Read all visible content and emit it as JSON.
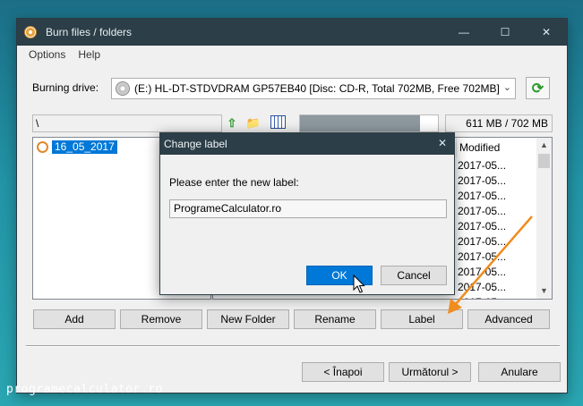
{
  "window": {
    "title": "Burn files / folders"
  },
  "menu": [
    "Options",
    "Help"
  ],
  "drive": {
    "label": "Burning drive:",
    "value": "(E:) HL-DT-STDVDRAM GP57EB40 [Disc: CD-R, Total 702MB, Free 702MB]"
  },
  "path": {
    "value": "\\"
  },
  "usage": {
    "text": "611 MB / 702 MB",
    "fraction": 0.87
  },
  "tree": {
    "item": "16_05_2017"
  },
  "filelist": {
    "column_modified": "Modified",
    "rows": [
      "2017-05...",
      "2017-05...",
      "2017-05...",
      "2017-05...",
      "2017-05...",
      "2017-05...",
      "2017-05...",
      "2017-05...",
      "2017-05...",
      "2017-05..."
    ]
  },
  "buttons": {
    "add": "Add",
    "remove": "Remove",
    "new_folder": "New Folder",
    "rename": "Rename",
    "label": "Label",
    "advanced": "Advanced"
  },
  "nav": {
    "back": "< Înapoi",
    "next": "Următorul >",
    "cancel": "Anulare"
  },
  "dialog": {
    "title": "Change label",
    "prompt": "Please enter the new label:",
    "value": "ProgrameCalculator.ro",
    "ok": "OK",
    "cancel": "Cancel",
    "close": "✕"
  },
  "watermark": "programecalculator.ro",
  "colors": {
    "titlebar": "#2c3e47",
    "accent": "#0078d7",
    "arrow": "#f08c1e"
  }
}
